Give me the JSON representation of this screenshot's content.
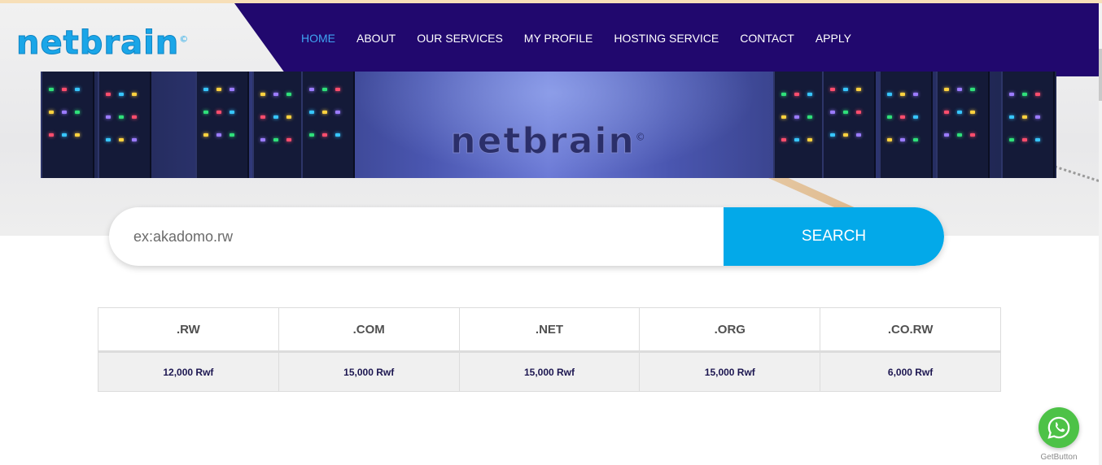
{
  "brand": {
    "logo_text": "netbrain",
    "logo_mark": "©"
  },
  "nav": {
    "items": [
      {
        "label": "HOME",
        "active": true
      },
      {
        "label": "ABOUT"
      },
      {
        "label": "OUR SERVICES"
      },
      {
        "label": "MY PROFILE"
      },
      {
        "label": "HOSTING SERVICE"
      },
      {
        "label": "CONTACT"
      },
      {
        "label": "APPLY"
      }
    ]
  },
  "banner": {
    "logo_text": "netbrain",
    "logo_mark": "©"
  },
  "search": {
    "placeholder": "ex:akadomo.rw",
    "button_label": "SEARCH"
  },
  "pricing": {
    "headers": [
      ".RW",
      ".COM",
      ".NET",
      ".ORG",
      ".CO.RW"
    ],
    "prices": [
      "12,000 Rwf",
      "15,000 Rwf",
      "15,000 Rwf",
      "15,000 Rwf",
      "6,000 Rwf"
    ]
  },
  "widget": {
    "icon": "whatsapp-icon",
    "caption": "GetButton"
  },
  "colors": {
    "nav_bg": "#21086e",
    "accent": "#03a9e9",
    "active_link": "#3fa4f2",
    "whatsapp": "#4dc247"
  }
}
